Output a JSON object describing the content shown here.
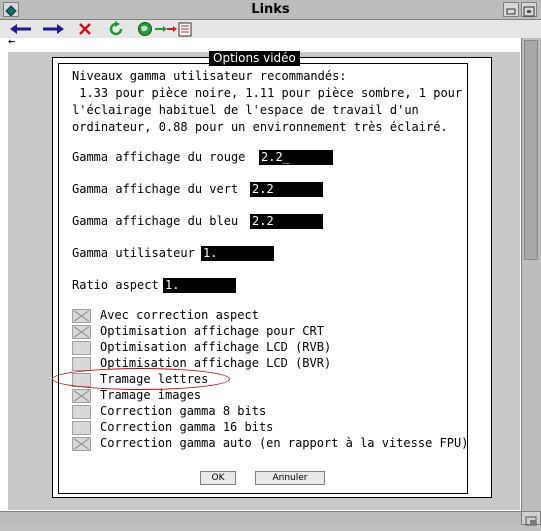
{
  "window": {
    "title": "Links"
  },
  "toolbar": {
    "back_glyph": "←"
  },
  "dialog": {
    "title": "Options vidéo",
    "intro": "Niveaux gamma utilisateur recommandés:\n 1.33 pour pièce noire, 1.11 pour pièce sombre, 1 pour\nl'éclairage habituel de l'espace de travail d'un\nordinateur, 0.88 pour un environnement très éclairé.",
    "fields": [
      {
        "label": "Gamma affichage du rouge",
        "value": "2.2_"
      },
      {
        "label": "Gamma affichage du vert",
        "value": "2.2"
      },
      {
        "label": "Gamma affichage du bleu",
        "value": "2.2"
      },
      {
        "label": "Gamma utilisateur",
        "value": "1."
      },
      {
        "label": "Ratio aspect",
        "value": "1."
      }
    ],
    "options": [
      {
        "label": "Avec correction aspect",
        "checked": true
      },
      {
        "label": "Optimisation affichage pour CRT",
        "checked": true
      },
      {
        "label": "Optimisation affichage LCD (RVB)",
        "checked": false
      },
      {
        "label": "Optimisation affichage LCD (BVR)",
        "checked": false
      },
      {
        "label": "Tramage lettres",
        "checked": false
      },
      {
        "label": "Tramage images",
        "checked": true
      },
      {
        "label": "Correction gamma 8 bits",
        "checked": false
      },
      {
        "label": "Correction gamma 16 bits",
        "checked": false
      },
      {
        "label": "Correction gamma auto (en rapport à la vitesse FPU)",
        "checked": true
      }
    ],
    "ok_label": "OK",
    "cancel_label": "Annuler"
  },
  "colors": {
    "highlight": "#cc0000",
    "accent_blue": "#1a1a9a",
    "reload_green": "#1e9a2e"
  }
}
